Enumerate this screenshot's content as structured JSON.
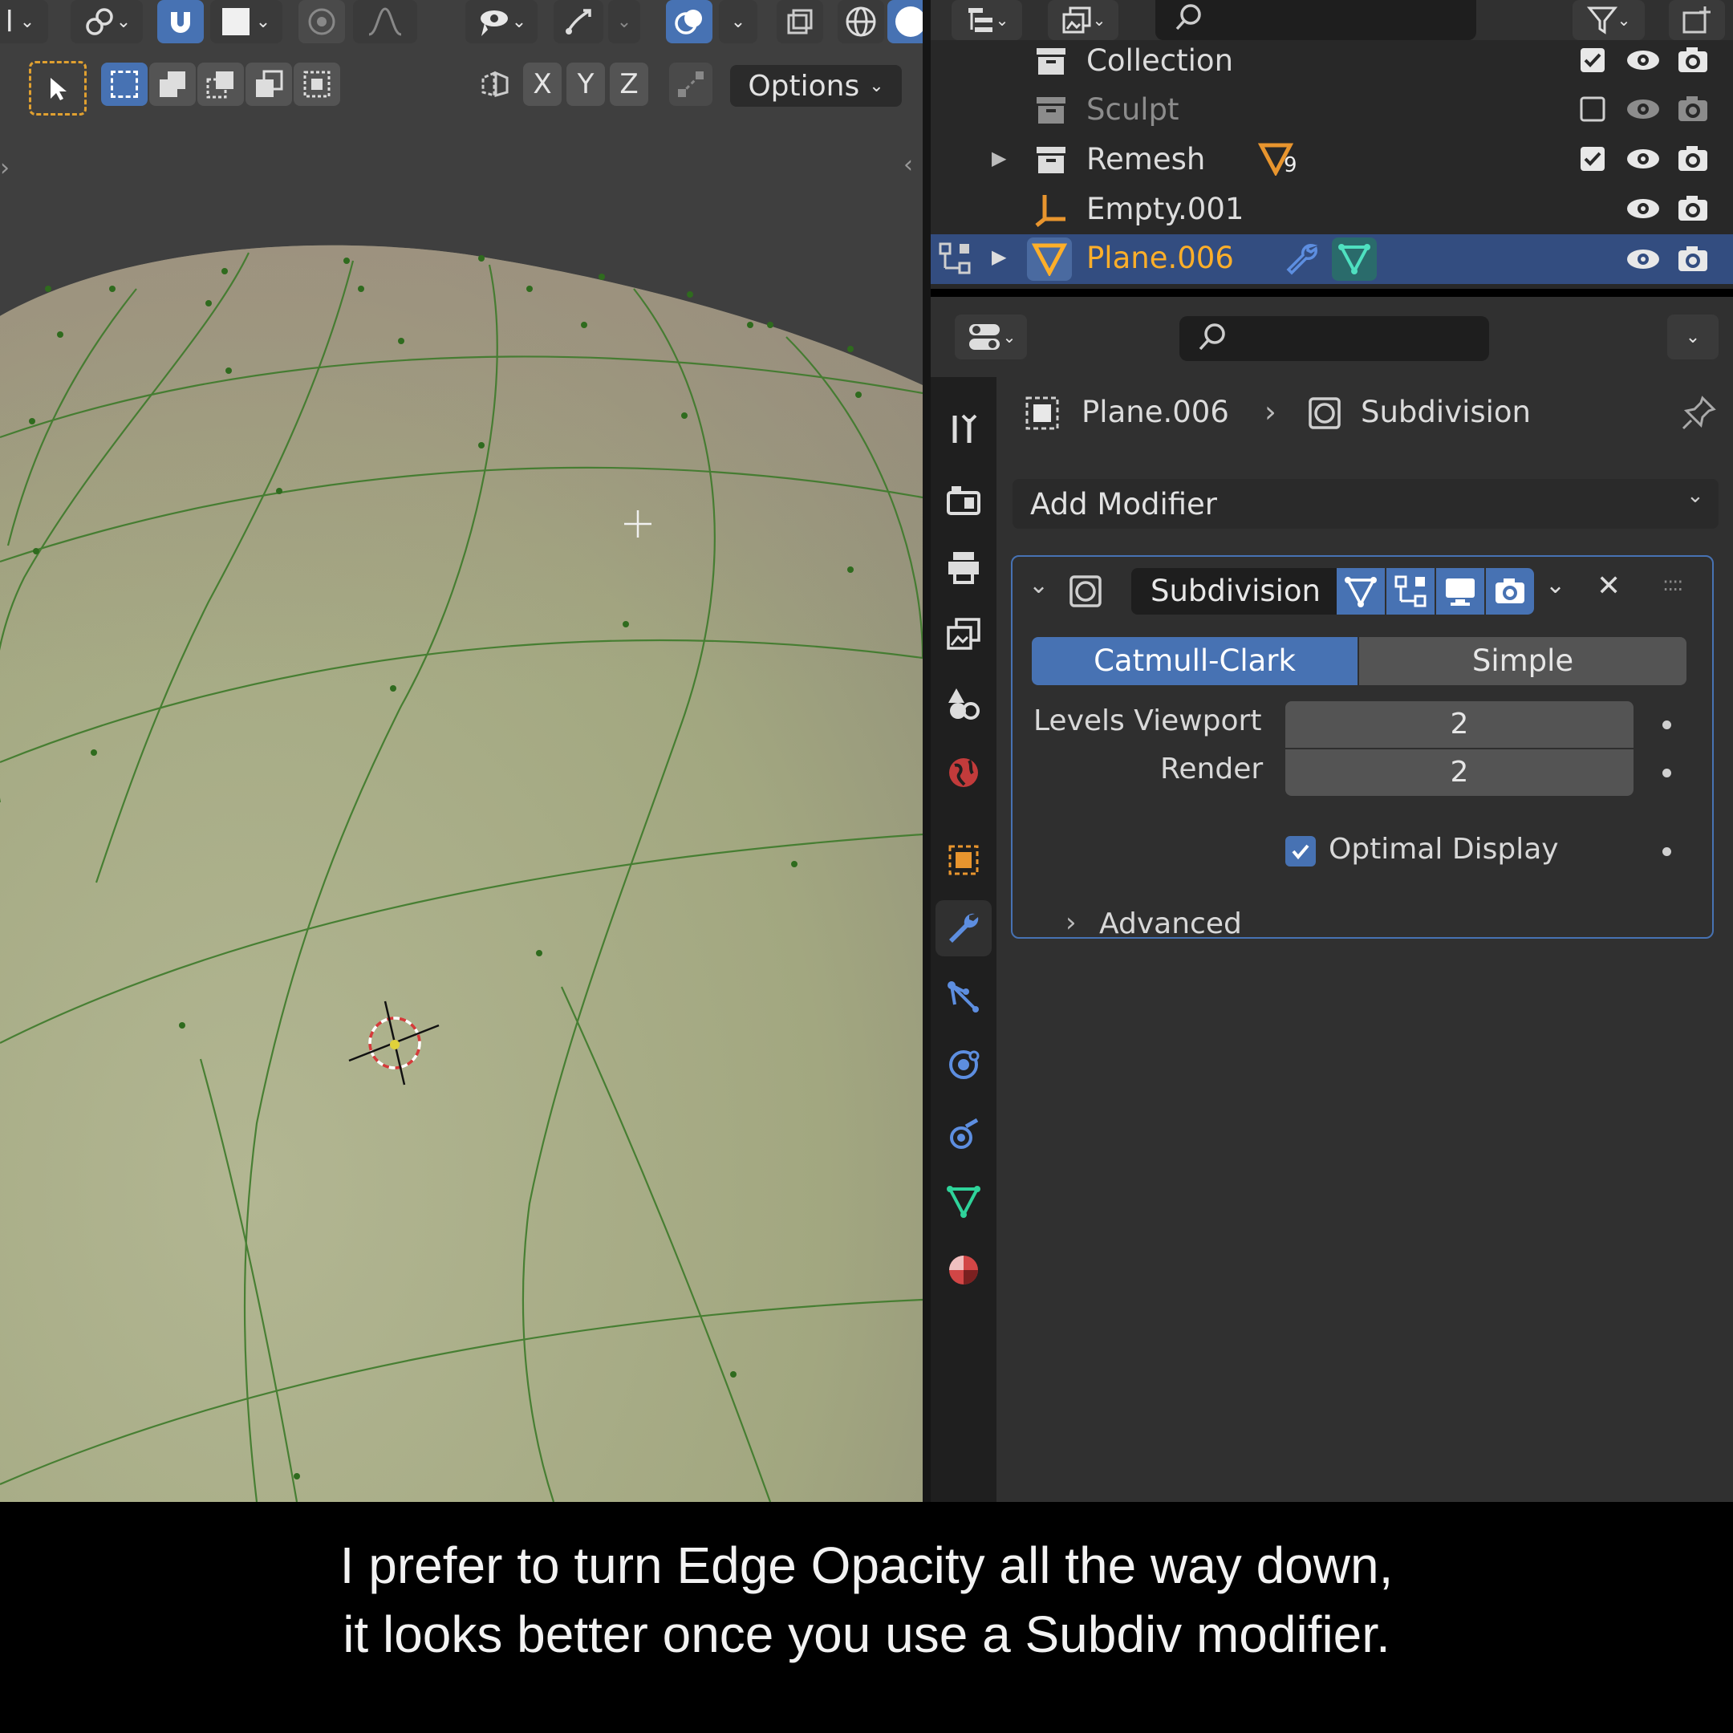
{
  "viewport": {
    "header": {
      "mode_fragment": "l",
      "axis_buttons": [
        "X",
        "Y",
        "Z"
      ],
      "options_label": "Options"
    }
  },
  "outliner": {
    "rows": [
      {
        "name": "Collection",
        "type": "collection",
        "checked": true,
        "selected": false
      },
      {
        "name": "Sculpt",
        "type": "collection",
        "checked": false,
        "selected": false
      },
      {
        "name": "Remesh",
        "type": "collection",
        "checked": true,
        "badge_count": "9",
        "selected": false
      },
      {
        "name": "Empty.001",
        "type": "empty",
        "selected": false
      },
      {
        "name": "Plane.006",
        "type": "mesh",
        "selected": true
      }
    ]
  },
  "properties": {
    "breadcrumb": {
      "object": "Plane.006",
      "modifier": "Subdivision"
    },
    "add_modifier_label": "Add Modifier",
    "modifier": {
      "name": "Subdivision",
      "modes": [
        "Catmull-Clark",
        "Simple"
      ],
      "active_mode": "Catmull-Clark",
      "levels_viewport_label": "Levels Viewport",
      "levels_viewport_value": "2",
      "render_label": "Render",
      "render_value": "2",
      "optimal_display_label": "Optimal Display",
      "optimal_display_checked": true,
      "advanced_label": "Advanced"
    }
  },
  "caption": {
    "line1": "I prefer to turn Edge Opacity all the way down,",
    "line2": "it looks better once you use a Subdiv modifier."
  },
  "colors": {
    "accent": "#4772b3",
    "selection_text": "#ffaf29",
    "mesh_wire": "#3d7a2a",
    "surface": "#a9ad88"
  }
}
